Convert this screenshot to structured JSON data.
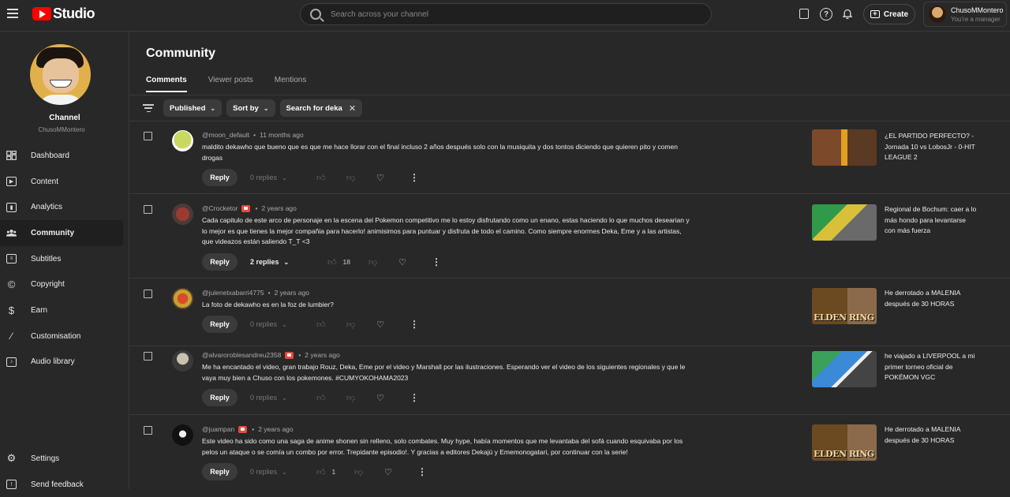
{
  "app": {
    "logo_text": "Studio"
  },
  "search": {
    "placeholder": "Search across your channel"
  },
  "header": {
    "create_label": "Create",
    "account_name": "ChusoMMontero",
    "account_role": "You're a manager"
  },
  "sidebar": {
    "channel_label": "Channel",
    "channel_handle": "ChusoMMontero",
    "items": [
      {
        "label": "Dashboard",
        "icon": "dashboard-icon"
      },
      {
        "label": "Content",
        "icon": "content-icon"
      },
      {
        "label": "Analytics",
        "icon": "analytics-icon"
      },
      {
        "label": "Community",
        "icon": "community-icon",
        "active": true
      },
      {
        "label": "Subtitles",
        "icon": "subtitles-icon"
      },
      {
        "label": "Copyright",
        "icon": "copyright-icon"
      },
      {
        "label": "Earn",
        "icon": "earn-icon"
      },
      {
        "label": "Customisation",
        "icon": "customisation-icon"
      },
      {
        "label": "Audio library",
        "icon": "audio-library-icon"
      }
    ],
    "bottom_items": [
      {
        "label": "Settings",
        "icon": "gear-icon"
      },
      {
        "label": "Send feedback",
        "icon": "feedback-icon"
      }
    ]
  },
  "main": {
    "title": "Community",
    "tabs": [
      "Comments",
      "Viewer posts",
      "Mentions"
    ],
    "active_tab": "Comments",
    "filters": {
      "published": "Published",
      "sort_by": "Sort by",
      "search_chip": "Search for deka"
    },
    "reply_label": "Reply",
    "comments": [
      {
        "author": "@moon_default",
        "time": "11 months ago",
        "member_badge": false,
        "text": "maldito dekawho que bueno que es que me hace llorar con el final incluso 2 años después solo con la musiquita y dos tontos diciendo que quieren pito y comen drogas",
        "replies": "0 replies",
        "likes": "",
        "video_title": "¿EL PARTIDO PERFECTO? - Jornada 10 vs LobosJr - 0-HIT LEAGUE 2"
      },
      {
        "author": "@Crocketor",
        "time": "2 years ago",
        "member_badge": true,
        "text": "Cada capitulo de este arco de personaje en la escena del Pokemon competitivo me lo estoy disfrutando como un enano, estas haciendo lo que muchos desearian y lo mejor es que tienes la mejor compañia para hacerlo! animisimos para puntuar y disfruta de todo el camino. Como siempre enormes Deka, Eme y a las artistas, que videazos están saliendo T_T <3",
        "replies": "2 replies",
        "likes": "18",
        "video_title": "Regional de Bochum: caer a lo más hondo para levantarse con más fuerza"
      },
      {
        "author": "@julenetxabarri4775",
        "time": "2 years ago",
        "member_badge": false,
        "text": "La foto de dekawho es en la foz de lumbier?",
        "replies": "0 replies",
        "likes": "",
        "video_title": "He derrotado a MALENIA después de 30 HORAS",
        "thumb_label": "ELDEN RING"
      },
      {
        "author": "@alvaroroblesandreu2358",
        "time": "2 years ago",
        "member_badge": true,
        "text": "Me ha encantado el video, gran trabajo Rouz, Deka, Eme por el video y Marshall por las ilustraciones. Esperando ver el video de los siguientes regionales y que le vaya muy bien a Chuso con los pokemones. #CUMYOKOHAMA2023",
        "replies": "0 replies",
        "likes": "",
        "video_title": "he viajado a LIVERPOOL a mi primer torneo oficial de POKÉMON VGC"
      },
      {
        "author": "@juampan",
        "time": "2 years ago",
        "member_badge": true,
        "text": "Este video ha sido como una saga de anime shonen sin relleno, solo combates. Muy hype, había momentos que me levantaba del sofá cuando esquivaba por los pelos un ataque o se comía un combo por error. Trepidante episodio!. Y gracias a editores Dekajú y Ememonogatari, por continuar con la serie!",
        "replies": "0 replies",
        "likes": "1",
        "video_title": "He derrotado a MALENIA después de 30 HORAS",
        "thumb_label": "ELDEN RING"
      }
    ]
  },
  "colors": {
    "background": "#282828",
    "accent_red": "#ff0000",
    "member_badge": "#e8483b"
  }
}
